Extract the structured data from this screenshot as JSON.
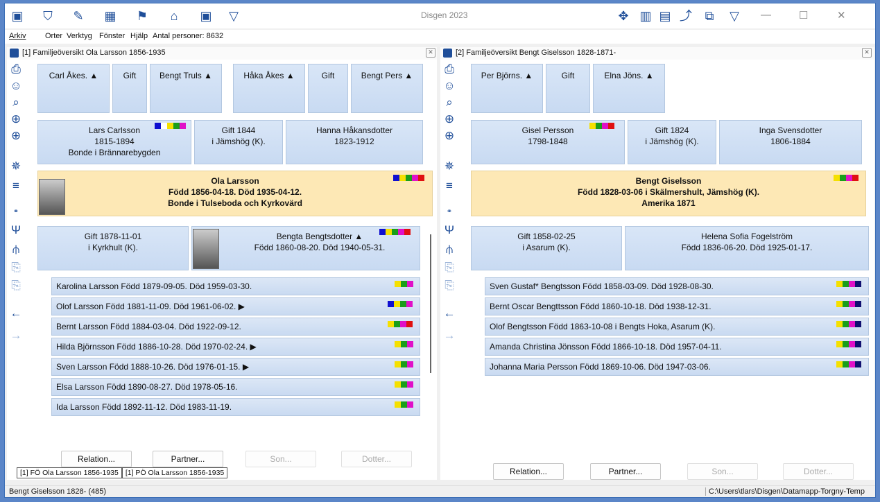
{
  "app": {
    "title": "Disgen 2023"
  },
  "menu": {
    "arkiv": "Arkiv",
    "orter": "Orter",
    "verktyg": "Verktyg",
    "fonster": "Fönster",
    "hjalp": "Hjälp",
    "antal": "Antal personer: 8632"
  },
  "left": {
    "header": "[1] Familjeöversikt Ola Larsson 1856-1935",
    "grandparents": [
      "Carl Åkes. ▲",
      "Gift",
      "Bengt Truls ▲",
      "Håka Åkes ▲",
      "Gift",
      "Bengt Pers ▲"
    ],
    "father": {
      "name": "Lars Carlsson",
      "years": "1815-1894",
      "place": "Bonde i Brännarebygden"
    },
    "parents_marriage": {
      "line1": "Gift 1844",
      "line2": "i Jämshög (K)."
    },
    "mother": {
      "name": "Hanna Håkansdotter",
      "years": "1823-1912"
    },
    "main": {
      "name": "Ola Larsson",
      "dates": "Född 1856-04-18. Död 1935-04-12.",
      "occupation": "Bonde i Tulseboda och Kyrkovärd"
    },
    "marriage": {
      "line1": "Gift 1878-11-01",
      "line2": "i Kyrkhult (K)."
    },
    "spouse": {
      "name": "Bengta Bengtsdotter ▲",
      "dates": "Född 1860-08-20. Död 1940-05-31."
    },
    "children": [
      "Karolina Larsson Född 1879-09-05. Död 1959-03-30.",
      "Olof Larsson Född 1881-11-09. Död 1961-06-02. ▶",
      "Bernt Larsson Född 1884-03-04. Död 1922-09-12.",
      "Hilda Björnsson Född 1886-10-28. Död 1970-02-24. ▶",
      "Sven Larsson Född 1888-10-26. Död 1976-01-15. ▶",
      "Elsa Larsson Född 1890-08-27. Död 1978-05-16.",
      "Ida Larsson Född 1892-11-12. Död 1983-11-19."
    ],
    "buttons": {
      "relation": "Relation...",
      "partner": "Partner...",
      "son": "Son...",
      "dotter": "Dotter..."
    },
    "tabs": [
      "[1] FÖ Ola Larsson 1856-1935",
      "[1] PÖ Ola Larsson 1856-1935"
    ]
  },
  "right": {
    "header": "[2] Familjeöversikt Bengt Giselsson 1828-1871-",
    "grandparents": [
      "Per Björns. ▲",
      "Gift",
      "Elna Jöns. ▲"
    ],
    "father": {
      "name": "Gisel Persson",
      "years": "1798-1848"
    },
    "parents_marriage": {
      "line1": "Gift 1824",
      "line2": "i Jämshög (K)."
    },
    "mother": {
      "name": "Inga Svensdotter",
      "years": "1806-1884"
    },
    "main": {
      "name": "Bengt Giselsson",
      "dates": "Född 1828-03-06 i Skälmershult, Jämshög (K).",
      "occupation": "Amerika 1871"
    },
    "marriage": {
      "line1": "Gift 1858-02-25",
      "line2": "i Asarum (K)."
    },
    "spouse": {
      "name": "Helena Sofia Fogelström",
      "dates": "Född 1836-06-20. Död 1925-01-17."
    },
    "children": [
      "Sven Gustaf* Bengtsson Född 1858-03-09. Död 1928-08-30.",
      "Bernt Oscar Bengttsson Född 1860-10-18. Död 1938-12-31.",
      "Olof Bengtsson Född 1863-10-08 i Bengts Hoka, Asarum (K).",
      "Amanda Christina Jönsson Född 1866-10-18. Död 1957-04-11.",
      "Johanna Maria Persson Född 1869-10-06. Död 1947-03-06."
    ],
    "buttons": {
      "relation": "Relation...",
      "partner": "Partner...",
      "son": "Son...",
      "dotter": "Dotter..."
    }
  },
  "status": {
    "left": "Bengt Giselsson 1828- (485)",
    "right": "C:\\Users\\tlars\\Disgen\\Datamapp-Torgny-Temp"
  }
}
